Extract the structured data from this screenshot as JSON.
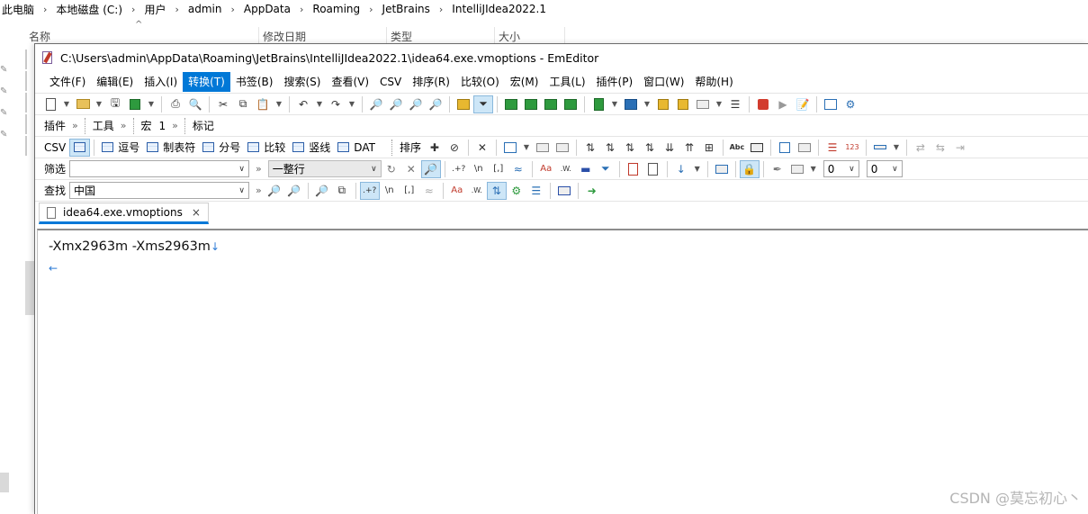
{
  "explorer": {
    "breadcrumb": [
      "此电脑",
      "本地磁盘 (C:)",
      "用户",
      "admin",
      "AppData",
      "Roaming",
      "JetBrains",
      "IntelliJIdea2022.1"
    ],
    "columns": [
      "名称",
      "修改日期",
      "类型",
      "大小"
    ]
  },
  "window": {
    "title": "C:\\Users\\admin\\AppData\\Roaming\\JetBrains\\IntelliJIdea2022.1\\idea64.exe.vmoptions - EmEditor"
  },
  "menu": {
    "items": [
      "文件(F)",
      "编辑(E)",
      "插入(I)",
      "转换(T)",
      "书签(B)",
      "搜索(S)",
      "查看(V)",
      "CSV",
      "排序(R)",
      "比较(O)",
      "宏(M)",
      "工具(L)",
      "插件(P)",
      "窗口(W)",
      "帮助(H)"
    ],
    "active": "转换(T)"
  },
  "toolbar2": {
    "plugins": "插件",
    "tools": "工具",
    "macros": "宏",
    "macros_num": "1",
    "markers": "标记"
  },
  "csvbar": {
    "csv": "CSV",
    "comma": "逗号",
    "tab": "制表符",
    "semicolon": "分号",
    "compare": "比较",
    "pipe": "竖线",
    "dat": "DAT",
    "sort": "排序",
    "abc": "Abc",
    "num": "123",
    "zero": "0"
  },
  "filterbar": {
    "label": "筛选",
    "value": "",
    "mode": "一整行",
    "regex": ".+?",
    "newline": "\\n",
    "bracket": "[,]",
    "aa": "Aa",
    "w": ".W.",
    "num1": "0",
    "num2": "0"
  },
  "findbar": {
    "label": "查找",
    "value": "中国"
  },
  "tab": {
    "name": "idea64.exe.vmoptions",
    "close": "×"
  },
  "document": {
    "lines": [
      "-Xmx2963m -Xms2963m",
      ""
    ],
    "newline_glyph": "↓",
    "eof_glyph": "←"
  },
  "watermark": "CSDN @莫忘初心丶"
}
